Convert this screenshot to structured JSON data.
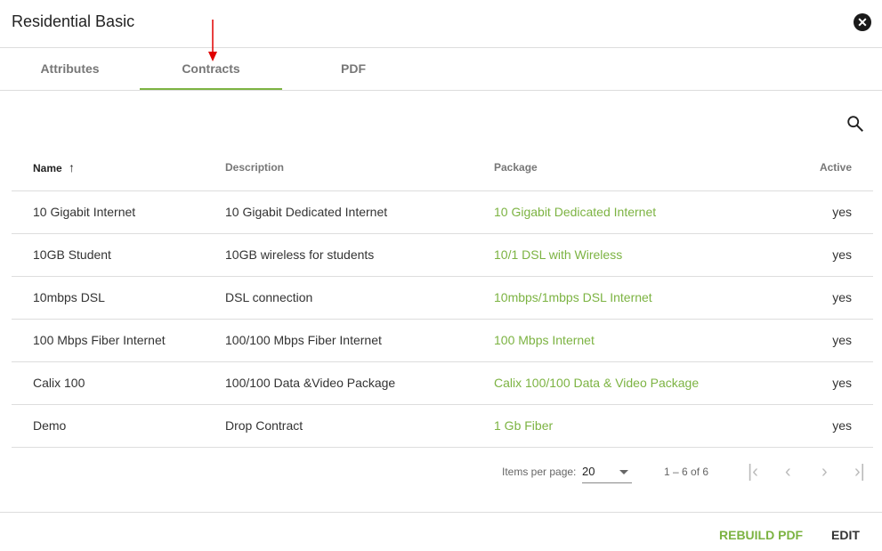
{
  "dialog": {
    "title": "Residential Basic"
  },
  "tabs": [
    {
      "label": "Attributes"
    },
    {
      "label": "Contracts",
      "active": true
    },
    {
      "label": "PDF"
    }
  ],
  "table": {
    "headers": {
      "name": "Name",
      "description": "Description",
      "package": "Package",
      "active": "Active"
    },
    "sort": {
      "column": "Name",
      "direction": "ascending"
    },
    "rows": [
      {
        "name": "10 Gigabit Internet",
        "description": "10 Gigabit Dedicated Internet",
        "package": "10 Gigabit Dedicated Internet",
        "active": "yes"
      },
      {
        "name": "10GB Student",
        "description": "10GB wireless for students",
        "package": "10/1 DSL with Wireless",
        "active": "yes"
      },
      {
        "name": "10mbps DSL",
        "description": "DSL connection",
        "package": "10mbps/1mbps DSL Internet",
        "active": "yes"
      },
      {
        "name": "100 Mbps Fiber Internet",
        "description": "100/100 Mbps Fiber Internet",
        "package": "100 Mbps Internet",
        "active": "yes"
      },
      {
        "name": "Calix 100",
        "description": "100/100 Data &Video Package",
        "package": "Calix 100/100 Data & Video Package",
        "active": "yes"
      },
      {
        "name": "Demo",
        "description": "Drop Contract",
        "package": "1 Gb Fiber",
        "active": "yes"
      }
    ]
  },
  "pagination": {
    "items_per_page_label": "Items per page:",
    "items_per_page": "20",
    "range": "1 – 6 of 6"
  },
  "footer": {
    "rebuild_pdf": "REBUILD PDF",
    "edit": "EDIT"
  },
  "colors": {
    "accent": "#7cb342",
    "annotation_arrow": "#e00000"
  }
}
